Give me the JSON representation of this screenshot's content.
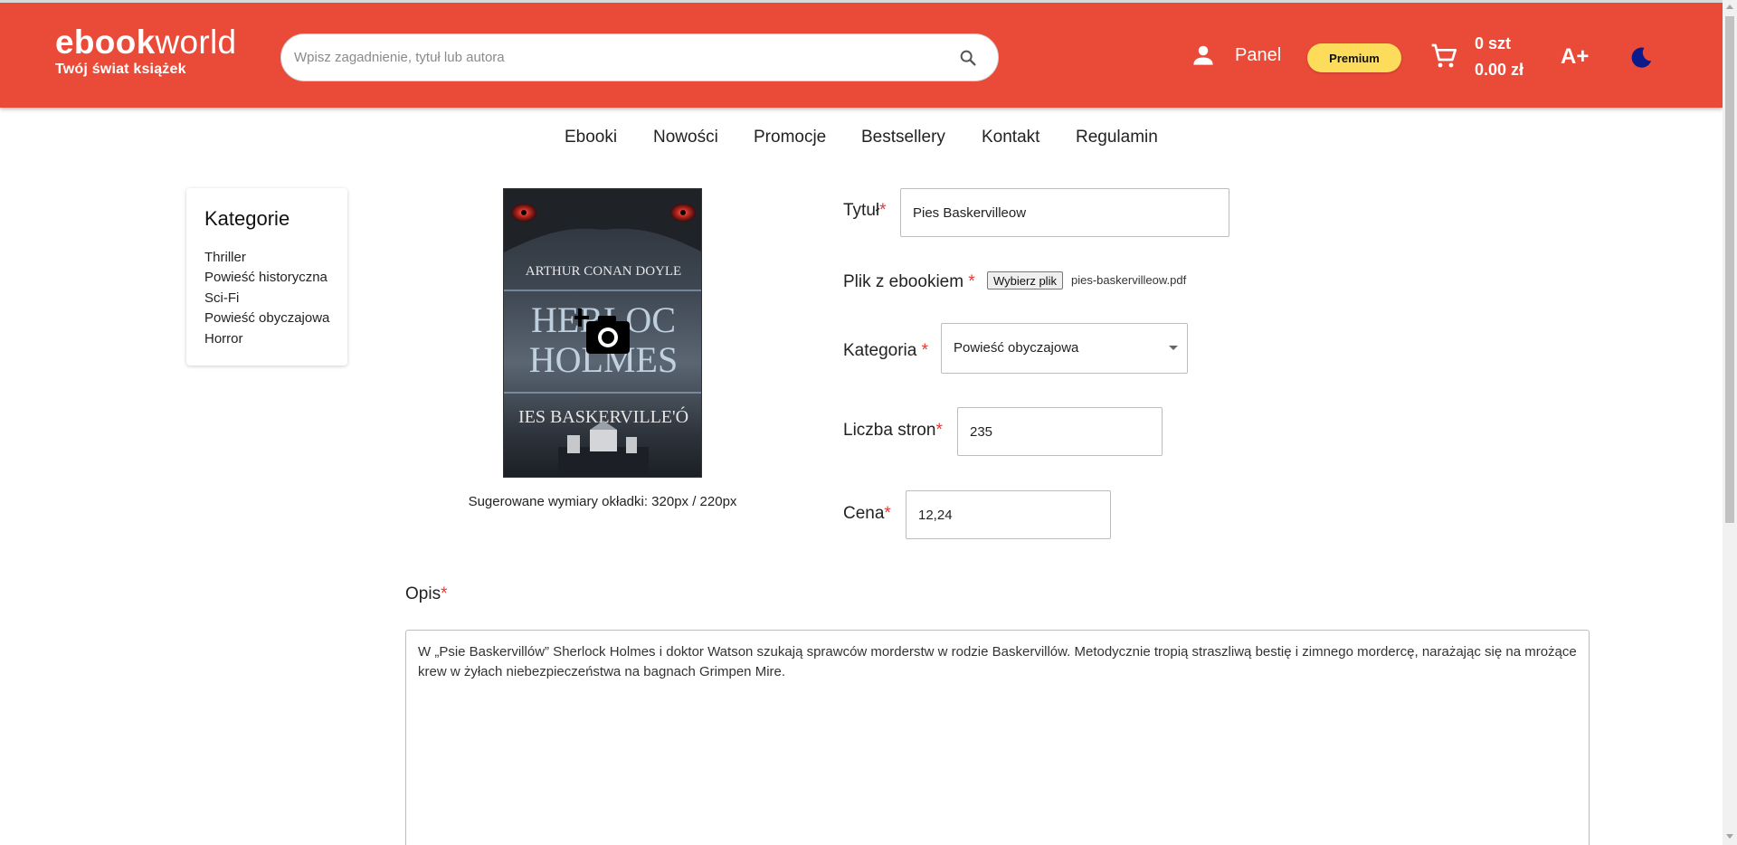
{
  "colors": {
    "header_bg": "#ea4a38",
    "premium_bg": "#fddc5c",
    "required_star": "#e53935",
    "theme_icon": "#0d1a8c"
  },
  "header": {
    "logo_bold": "ebook",
    "logo_light": "world",
    "tagline": "Twój świat książek",
    "search": {
      "placeholder": "Wpisz zagadnienie, tytuł lub autora",
      "icon": "search-icon"
    },
    "panel_label": "Panel",
    "premium_label": "Premium",
    "cart": {
      "count": "0 szt",
      "total": "0.00 zł"
    },
    "font_size_label": "A+"
  },
  "nav": {
    "items": [
      {
        "label": "Ebooki"
      },
      {
        "label": "Nowości"
      },
      {
        "label": "Promocje"
      },
      {
        "label": "Bestsellery"
      },
      {
        "label": "Kontakt"
      },
      {
        "label": "Regulamin"
      }
    ]
  },
  "categories": {
    "title": "Kategorie",
    "items": [
      {
        "label": "Thriller"
      },
      {
        "label": "Powieść historyczna"
      },
      {
        "label": "Sci-Fi"
      },
      {
        "label": "Powieść obyczajowa"
      },
      {
        "label": "Horror"
      }
    ]
  },
  "cover": {
    "author": "ARTHUR CONAN DOYLE",
    "series_line1": "HERLOC",
    "series_line2": "HOLMES",
    "book_title": "IES BASKERVILLE'Ó",
    "hint": "Sugerowane wymiary okładki: 320px / 220px"
  },
  "form": {
    "title": {
      "label": "Tytuł",
      "required": "*",
      "value": "Pies Baskervilleow"
    },
    "file": {
      "label": "Plik z ebookiem",
      "required": "*",
      "button": "Wybierz plik",
      "file_name": "pies-baskervilleow.pdf"
    },
    "category": {
      "label": "Kategoria",
      "required": "*",
      "value": "Powieść obyczajowa"
    },
    "pages": {
      "label": "Liczba stron",
      "required": "*",
      "value": "235"
    },
    "price": {
      "label": "Cena",
      "required": "*",
      "value": "12,24"
    },
    "description": {
      "label": "Opis",
      "required": "*",
      "value": "W „Psie Baskervillów” Sherlock Holmes i doktor Watson szukają sprawców morderstw w rodzie Baskervillów. Metodycznie tropią straszliwą bestię i zimnego mordercę, narażając się na mrożące krew w żyłach niebezpieczeństwa na bagnach Grimpen Mire."
    }
  }
}
